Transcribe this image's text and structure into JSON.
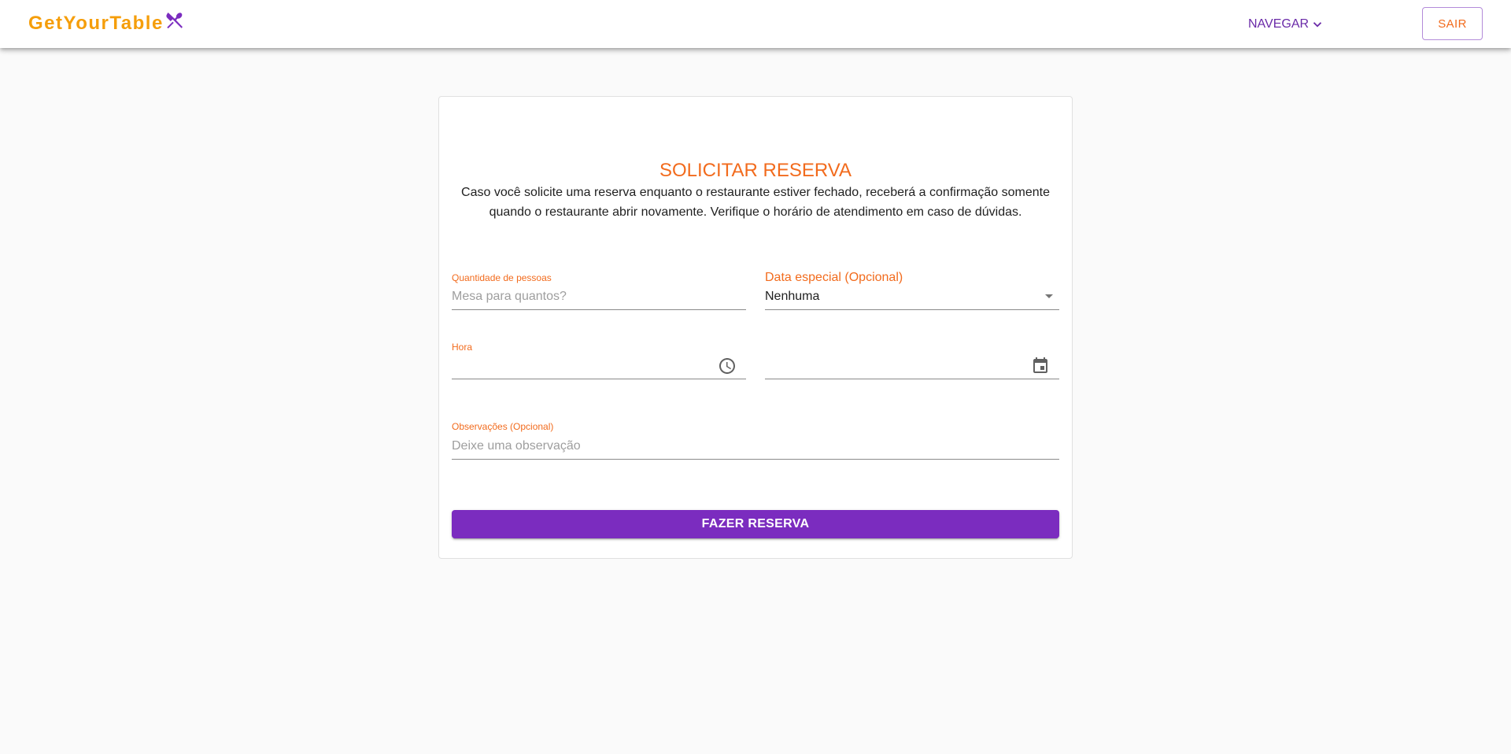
{
  "colors": {
    "brand_orange": "#f59e0b",
    "accent_orange": "#f26b1d",
    "primary_purple": "#7b2cbf",
    "nav_purple": "#6a2aa8"
  },
  "header": {
    "brand_name": "GetYourTable",
    "brand_icon": "fork-knife-crossed-icon",
    "nav_label": "NAVEGAR",
    "nav_icon": "chevron-down-icon",
    "logout_label": "SAIR"
  },
  "form": {
    "title": "SOLICITAR RESERVA",
    "notice": "Caso você solicite uma reserva enquanto o restaurante estiver fechado, receberá a confirmação somente quando o restaurante abrir novamente. Verifique o horário de atendimento em caso de dúvidas.",
    "people": {
      "label": "Quantidade de pessoas",
      "placeholder": "Mesa para quantos?"
    },
    "special_date": {
      "label": "Data especial (Opcional)",
      "value": "Nenhuma"
    },
    "time": {
      "label": "Hora",
      "value": "",
      "icon": "clock-icon"
    },
    "date": {
      "value": "",
      "icon": "calendar-icon"
    },
    "notes": {
      "label": "Observações (Opcional)",
      "placeholder": "Deixe uma observação"
    },
    "submit_label": "FAZER RESERVA"
  }
}
